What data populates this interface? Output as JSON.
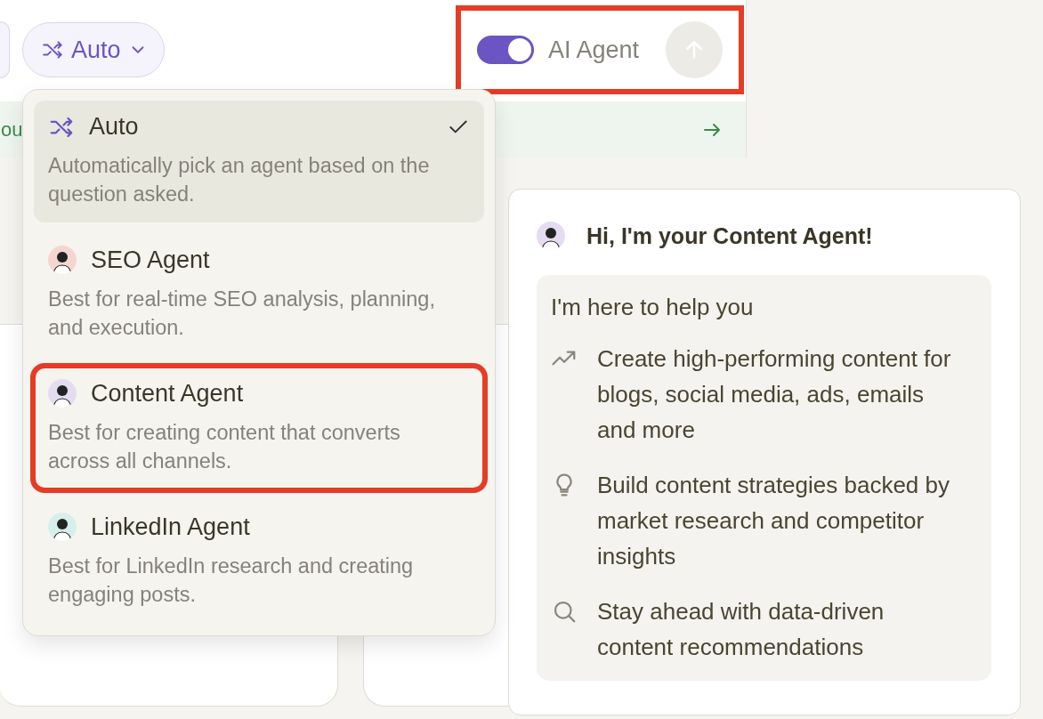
{
  "mode_button": {
    "label": "Auto"
  },
  "ai_agent": {
    "label": "AI Agent",
    "on": true,
    "highlighted": true
  },
  "banner": {
    "text": "ou"
  },
  "agent_menu": {
    "items": [
      {
        "kind": "auto",
        "name": "Auto",
        "description": "Automatically pick an agent based on the question asked.",
        "selected": true,
        "highlighted": false
      },
      {
        "kind": "avatar",
        "color": "#f4d6d0",
        "name": "SEO Agent",
        "description": "Best for real-time SEO analysis, planning, and execution.",
        "selected": false,
        "highlighted": false
      },
      {
        "kind": "avatar",
        "color": "#e6dcf1",
        "name": "Content Agent",
        "description": "Best for creating content that converts across all channels.",
        "selected": false,
        "highlighted": true
      },
      {
        "kind": "avatar",
        "color": "#d6efec",
        "name": "LinkedIn Agent",
        "description": "Best for LinkedIn research and creating engaging posts.",
        "selected": false,
        "highlighted": false
      }
    ]
  },
  "chat": {
    "avatar": {
      "color": "#e6dcf1"
    },
    "title": "Hi, I'm your Content Agent!",
    "intro": "I'm here to help you",
    "points": [
      {
        "kind": "trend",
        "text": "Create high-performing content for blogs, social media, ads, emails and more"
      },
      {
        "kind": "bulb",
        "text": "Build content strategies backed by market research and competitor insights"
      },
      {
        "kind": "search",
        "text": "Stay ahead with data-driven content recommendations"
      }
    ]
  }
}
